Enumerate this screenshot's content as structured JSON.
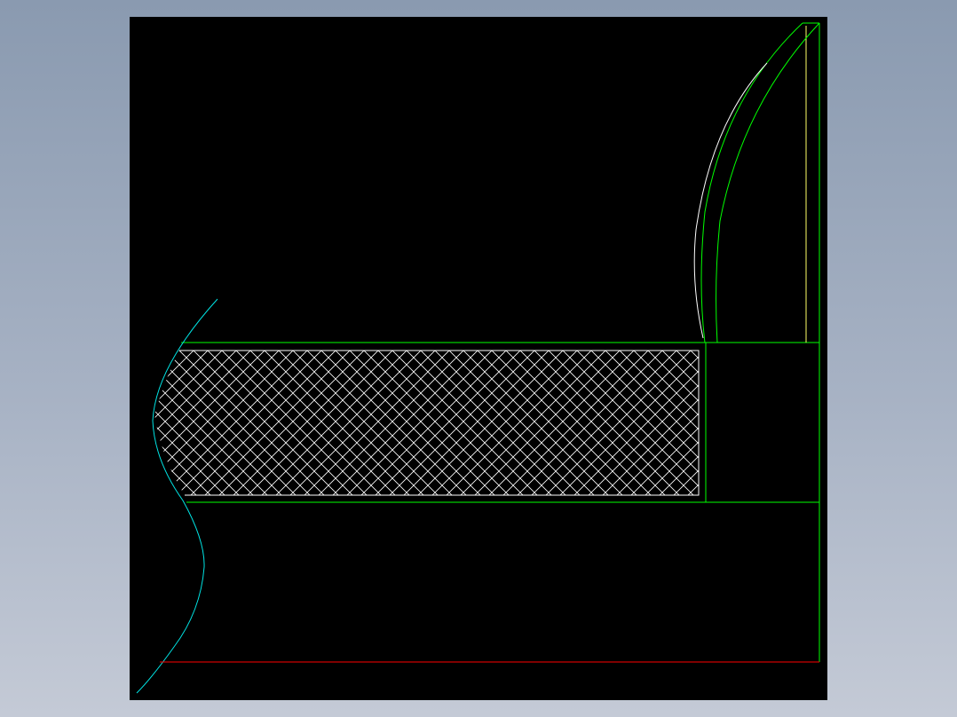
{
  "colors": {
    "background_gradient_top": "#8a9ab0",
    "background_gradient_bottom": "#c4cad6",
    "drawing_background": "#000000",
    "outline": "#00ff00",
    "hatch": "#ffffff",
    "break_line": "#00e5e5",
    "baseline": "#ff0000",
    "curve_outer": "#ffffff",
    "vertical_edge": "#ffff66"
  },
  "icons": {
    "drawing": "cad-section-drawing-icon"
  }
}
